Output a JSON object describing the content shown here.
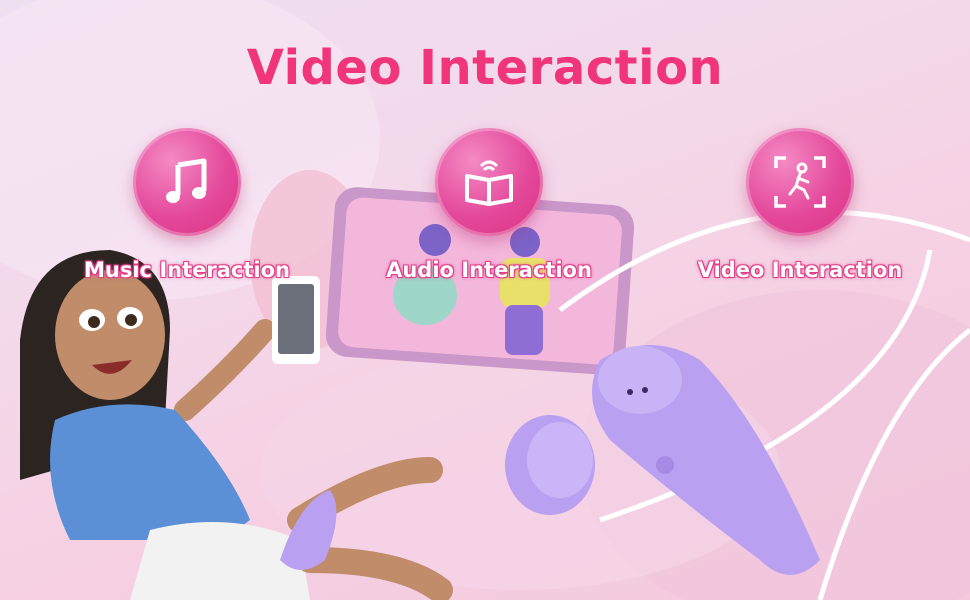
{
  "headline": "Video Interaction",
  "features": [
    {
      "label": "Music Interaction",
      "icon": "music-note-icon"
    },
    {
      "label": "Audio Interaction",
      "icon": "audio-book-icon"
    },
    {
      "label": "Video Interaction",
      "icon": "video-motion-icon"
    }
  ],
  "colors": {
    "accent": "#f0357a",
    "circle": "#e4489b",
    "device": "#b9a0f0",
    "shirt": "#5b8fd6"
  }
}
